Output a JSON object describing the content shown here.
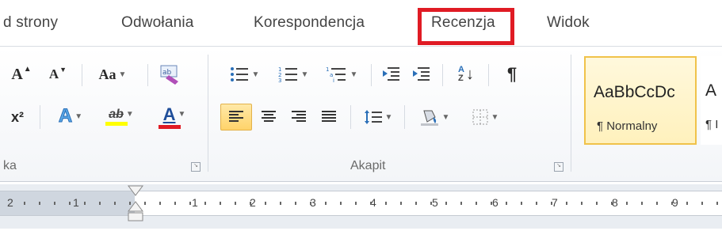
{
  "tabs": [
    {
      "label": "d strony"
    },
    {
      "label": "Odwołania"
    },
    {
      "label": "Korespondencja"
    },
    {
      "label": "Recenzja"
    },
    {
      "label": "Widok"
    }
  ],
  "highlight_color": "#e01b24",
  "font_group": {
    "label": "ka",
    "grow_font": "A",
    "shrink_font": "A",
    "change_case": "Aa",
    "superscript": "x²",
    "text_effects": "A",
    "highlight": "ab",
    "font_color": "A"
  },
  "paragraph_group": {
    "label": "Akapit",
    "show_marks": "¶",
    "sort": "AZ"
  },
  "styles": [
    {
      "preview": "AaBbCcDc",
      "name": "¶ Normalny"
    },
    {
      "preview": "A",
      "name": "¶ I"
    }
  ],
  "ruler": {
    "labels": [
      "2",
      "1",
      "1",
      "2",
      "3",
      "4",
      "5",
      "6",
      "7",
      "8",
      "9"
    ]
  }
}
